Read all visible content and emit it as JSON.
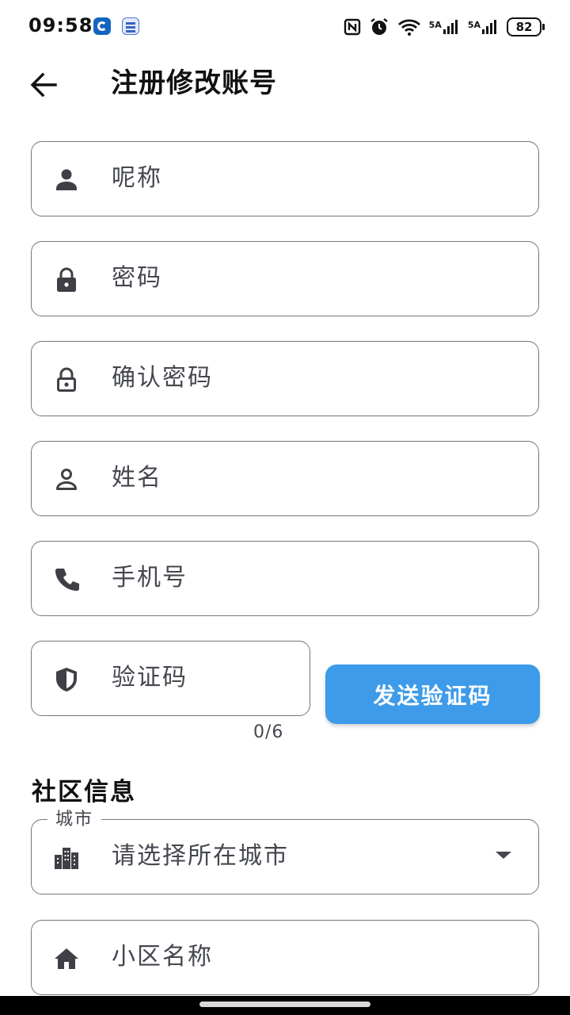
{
  "status_bar": {
    "time": "09:58",
    "battery": "82",
    "network_1": "5A",
    "network_2": "5A"
  },
  "header": {
    "title": "注册修改账号"
  },
  "fields": {
    "nickname": "呢称",
    "password": "密码",
    "confirm_password": "确认密码",
    "name": "姓名",
    "phone": "手机号",
    "code": "验证码"
  },
  "code_counter": "0/6",
  "send_code_button": "发送验证码",
  "community_section": {
    "title": "社区信息",
    "city_label": "城市",
    "city_placeholder": "请选择所在城市",
    "community_name": "小区名称"
  },
  "colors": {
    "accent": "#3d9be9",
    "outline": "#74777f",
    "text": "#44474e"
  }
}
